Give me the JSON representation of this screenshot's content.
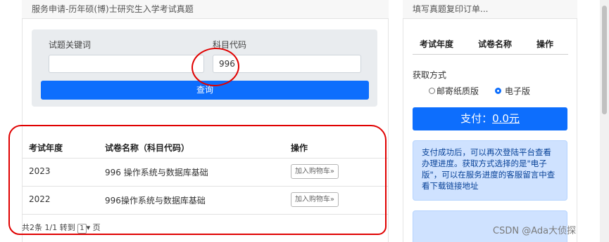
{
  "left": {
    "header_title": "服务申请-历年硕(博)士研究生入学考试真题",
    "search": {
      "keyword_label": "试题关键词",
      "keyword_value": "",
      "subject_label": "科目代码",
      "subject_value": "996",
      "query_button": "查询"
    },
    "table": {
      "headers": [
        "考试年度",
        "试卷名称（科目代码）",
        "操作"
      ],
      "rows": [
        {
          "year": "2023",
          "name": "996 操作系统与数据库基础",
          "action": "加入购物车»"
        },
        {
          "year": "2022",
          "name": "996操作系统与数据库基础",
          "action": "加入购物车»"
        }
      ]
    },
    "pager": {
      "total": "共2条",
      "pages": "1/1 转到",
      "page_select": "1",
      "suffix": "页"
    }
  },
  "right": {
    "header_title": "填写真题复印订单...",
    "table_headers": [
      "考试年度",
      "试卷名称",
      "操作"
    ],
    "method_label": "获取方式",
    "options": [
      {
        "label": "邮寄纸质版",
        "checked": false
      },
      {
        "label": "电子版",
        "checked": true
      }
    ],
    "pay_label": "支付：",
    "pay_amount": "0.0元",
    "info_text": "支付成功后，可以再次登陆平台查看办理进度。获取方式选择的是\"电子版\"，可以在服务进度的客服留言中查看下载链接地址"
  },
  "watermark": "CSDN @Ada大侦探",
  "colors": {
    "primary": "#0d6efd",
    "annotation": "#e00000",
    "info_bg": "#cfe2ff"
  }
}
